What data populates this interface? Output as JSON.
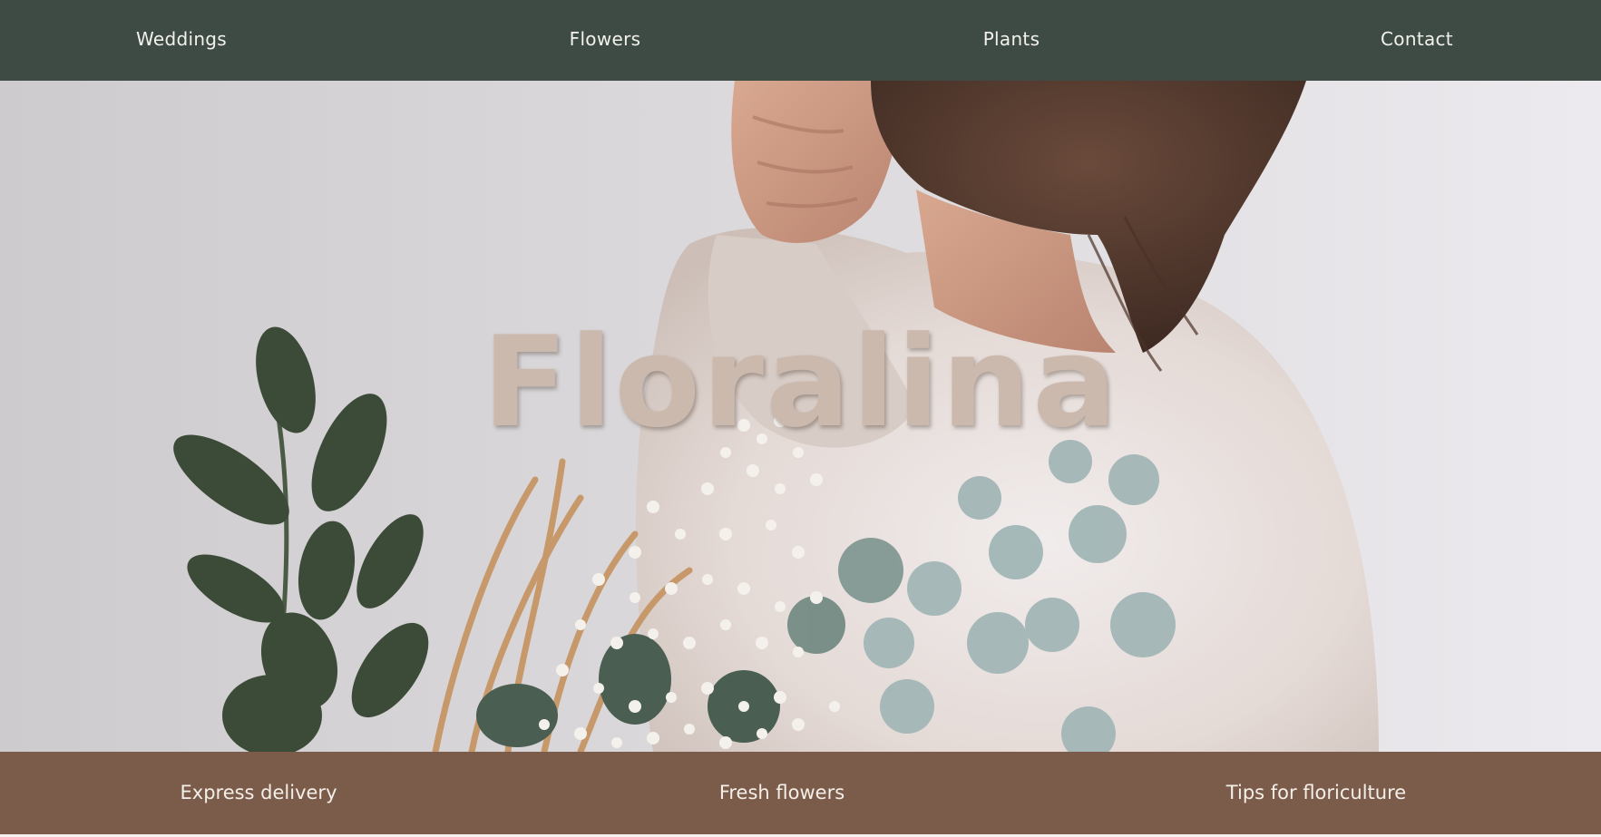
{
  "nav": {
    "items": [
      {
        "label": "Weddings"
      },
      {
        "label": "Flowers"
      },
      {
        "label": "Plants"
      },
      {
        "label": "Contact"
      }
    ]
  },
  "hero": {
    "title": "Floralina",
    "image_subject": "woman-holding-dried-flower-bouquet"
  },
  "features": {
    "items": [
      {
        "label": "Express delivery"
      },
      {
        "label": "Fresh flowers"
      },
      {
        "label": "Tips for floriculture"
      }
    ]
  },
  "colors": {
    "nav_bg": "#3e4a44",
    "feature_bg": "#7b5b49",
    "title_color": "#cbb9ae",
    "text_light": "#f3f1ec"
  }
}
